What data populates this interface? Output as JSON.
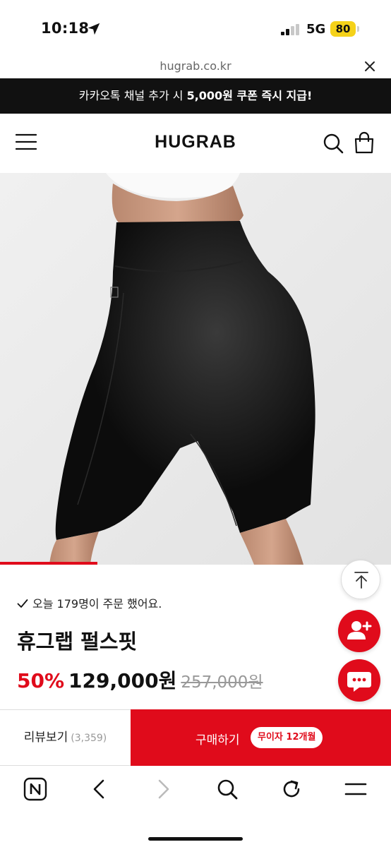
{
  "status_bar": {
    "time": "10:18",
    "network": "5G",
    "battery": "80"
  },
  "url_bar": {
    "url": "hugrab.co.kr"
  },
  "promo": {
    "text_prefix": "카카오톡 채널 추가 시 ",
    "text_bold": "5,000원 쿠폰 즉시 지급!"
  },
  "header": {
    "logo": "HUGRAB"
  },
  "product": {
    "order_note": "오늘 179명이 주문 했어요.",
    "name": "휴그랩 펄스핏",
    "discount": "50%",
    "price": "129,000원",
    "original_price": "257,000원"
  },
  "action_bar": {
    "review_label": "리뷰보기",
    "review_count": "(3,359)",
    "buy_label": "구매하기",
    "interest_badge": "무이자 12개월"
  },
  "colors": {
    "accent": "#e00b1b",
    "promo_bg": "#111111",
    "battery": "#f5d21a"
  },
  "icons": [
    "location-arrow-icon",
    "signal-icon",
    "close-icon",
    "menu-icon",
    "search-icon",
    "bag-icon",
    "check-icon",
    "arrow-up-icon",
    "add-user-icon",
    "chat-icon",
    "naver-icon",
    "back-icon",
    "forward-icon",
    "refresh-icon"
  ]
}
